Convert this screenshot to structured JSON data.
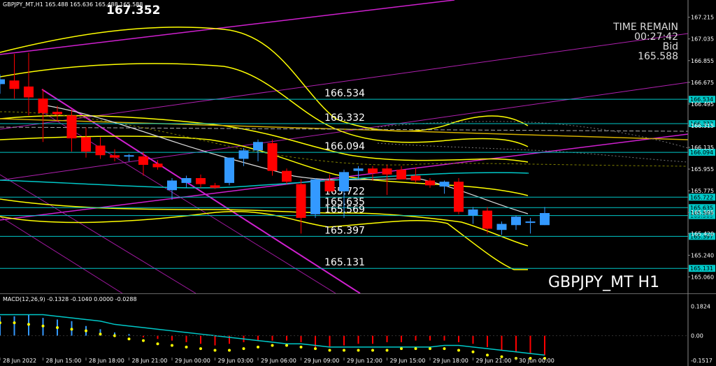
{
  "header": {
    "symbol_info": "GBPJPY_MT,H1  165.488 165.636 165.488 165.588",
    "big_price": "167.352"
  },
  "timer": {
    "label": "TIME REMAIN",
    "value": "00:27:42",
    "bid_label": "Bid",
    "bid_value": "165.588"
  },
  "watermark": "GBPJPY_MT H1",
  "colors": {
    "background": "#000000",
    "bull": "#3399ff",
    "bear": "#ff0000",
    "cyan": "#00c8c8",
    "yellow": "#ffff00",
    "magenta": "#d020d0",
    "grid": "#3a3a3a"
  },
  "chart_data": [
    {
      "type": "candlestick",
      "ylim": [
        164.97,
        167.3
      ],
      "y_ticks": [
        "167.215",
        "167.035",
        "166.855",
        "166.675",
        "166.495",
        "166.315",
        "166.135",
        "165.955",
        "165.775",
        "165.595",
        "165.420",
        "165.240",
        "165.060"
      ],
      "x_ticks": [
        "28 Jun 2022",
        "28 Jun 15:00",
        "28 Jun 18:00",
        "28 Jun 21:00",
        "29 Jun 00:00",
        "29 Jun 03:00",
        "29 Jun 06:00",
        "29 Jun 09:00",
        "29 Jun 12:00",
        "29 Jun 15:00",
        "29 Jun 18:00",
        "29 Jun 21:00",
        "30 Jun 00:00"
      ],
      "x_tick_bar_index": [
        0,
        3,
        6,
        9,
        12,
        15,
        18,
        21,
        24,
        27,
        30,
        33,
        36
      ],
      "candles": [
        {
          "o": 166.66,
          "h": 166.74,
          "l": 166.58,
          "c": 166.7
        },
        {
          "o": 166.69,
          "h": 166.91,
          "l": 166.54,
          "c": 166.62
        },
        {
          "o": 166.64,
          "h": 166.92,
          "l": 166.4,
          "c": 166.55
        },
        {
          "o": 166.54,
          "h": 166.62,
          "l": 166.18,
          "c": 166.42
        },
        {
          "o": 166.43,
          "h": 166.48,
          "l": 166.35,
          "c": 166.41
        },
        {
          "o": 166.4,
          "h": 166.45,
          "l": 166.1,
          "c": 166.21
        },
        {
          "o": 166.22,
          "h": 166.3,
          "l": 166.05,
          "c": 166.1
        },
        {
          "o": 166.15,
          "h": 166.22,
          "l": 166.04,
          "c": 166.07
        },
        {
          "o": 166.07,
          "h": 166.12,
          "l": 166.02,
          "c": 166.05
        },
        {
          "o": 166.06,
          "h": 166.08,
          "l": 166.02,
          "c": 166.07
        },
        {
          "o": 166.06,
          "h": 166.1,
          "l": 165.9,
          "c": 165.99
        },
        {
          "o": 166.0,
          "h": 166.03,
          "l": 165.95,
          "c": 165.97
        },
        {
          "o": 165.78,
          "h": 165.88,
          "l": 165.7,
          "c": 165.86
        },
        {
          "o": 165.84,
          "h": 165.9,
          "l": 165.8,
          "c": 165.88
        },
        {
          "o": 165.88,
          "h": 165.91,
          "l": 165.8,
          "c": 165.83
        },
        {
          "o": 165.82,
          "h": 165.84,
          "l": 165.79,
          "c": 165.8
        },
        {
          "o": 165.84,
          "h": 166.05,
          "l": 165.82,
          "c": 166.05
        },
        {
          "o": 166.04,
          "h": 166.13,
          "l": 165.98,
          "c": 166.11
        },
        {
          "o": 166.11,
          "h": 166.2,
          "l": 166.02,
          "c": 166.18
        },
        {
          "o": 166.17,
          "h": 166.2,
          "l": 165.9,
          "c": 165.94
        },
        {
          "o": 165.94,
          "h": 165.96,
          "l": 165.83,
          "c": 165.85
        },
        {
          "o": 165.83,
          "h": 165.87,
          "l": 165.42,
          "c": 165.55
        },
        {
          "o": 165.58,
          "h": 165.88,
          "l": 165.55,
          "c": 165.87
        },
        {
          "o": 165.86,
          "h": 165.91,
          "l": 165.76,
          "c": 165.77
        },
        {
          "o": 165.77,
          "h": 165.95,
          "l": 165.55,
          "c": 165.93
        },
        {
          "o": 165.94,
          "h": 165.98,
          "l": 165.87,
          "c": 165.96
        },
        {
          "o": 165.96,
          "h": 165.98,
          "l": 165.86,
          "c": 165.92
        },
        {
          "o": 165.96,
          "h": 165.99,
          "l": 165.74,
          "c": 165.91
        },
        {
          "o": 165.95,
          "h": 165.98,
          "l": 165.88,
          "c": 165.87
        },
        {
          "o": 165.9,
          "h": 165.97,
          "l": 165.84,
          "c": 165.86
        },
        {
          "o": 165.86,
          "h": 165.88,
          "l": 165.8,
          "c": 165.82
        },
        {
          "o": 165.81,
          "h": 165.86,
          "l": 165.75,
          "c": 165.85
        },
        {
          "o": 165.85,
          "h": 165.88,
          "l": 165.58,
          "c": 165.6
        },
        {
          "o": 165.57,
          "h": 165.64,
          "l": 165.5,
          "c": 165.62
        },
        {
          "o": 165.61,
          "h": 165.64,
          "l": 165.42,
          "c": 165.46
        },
        {
          "o": 165.45,
          "h": 165.52,
          "l": 165.41,
          "c": 165.5
        },
        {
          "o": 165.49,
          "h": 165.57,
          "l": 165.45,
          "c": 165.56
        },
        {
          "o": 165.52,
          "h": 165.55,
          "l": 165.42,
          "c": 165.52
        },
        {
          "o": 165.49,
          "h": 165.64,
          "l": 165.49,
          "c": 165.59
        }
      ],
      "levels": [
        {
          "value": 166.534,
          "label": "166.534"
        },
        {
          "value": 166.332,
          "label": "166.332"
        },
        {
          "value": 166.094,
          "label": "166.094"
        },
        {
          "value": 165.722,
          "label": "165.722"
        },
        {
          "value": 165.635,
          "label": "165.635"
        },
        {
          "value": 165.569,
          "label": "165.569"
        },
        {
          "value": 165.397,
          "label": "165.397"
        },
        {
          "value": 165.131,
          "label": "165.131"
        }
      ],
      "levels_right_only": [
        {
          "value": 165.589,
          "label": "165.589"
        }
      ]
    },
    {
      "type": "bar",
      "title": "MACD(12,26,9) -0.1328 -0.1040 0.0000 -0.0288",
      "ylim": [
        -0.17,
        0.21
      ],
      "y_ticks": [
        "0.1824",
        "0.00",
        "-0.1517"
      ],
      "histogram": [
        0.12,
        0.12,
        0.13,
        0.11,
        0.1,
        0.09,
        0.06,
        0.04,
        0.02,
        0.01,
        -0.01,
        -0.02,
        -0.03,
        -0.04,
        -0.05,
        -0.06,
        -0.05,
        -0.04,
        -0.03,
        -0.03,
        -0.03,
        -0.04,
        -0.07,
        -0.07,
        -0.06,
        -0.05,
        -0.05,
        -0.04,
        -0.04,
        -0.03,
        -0.03,
        -0.03,
        -0.04,
        -0.05,
        -0.07,
        -0.09,
        -0.1,
        -0.11,
        -0.12
      ],
      "signal": [
        0.13,
        0.13,
        0.13,
        0.13,
        0.12,
        0.11,
        0.1,
        0.09,
        0.07,
        0.06,
        0.05,
        0.04,
        0.03,
        0.02,
        0.01,
        0.0,
        -0.01,
        -0.02,
        -0.03,
        -0.04,
        -0.05,
        -0.05,
        -0.06,
        -0.07,
        -0.07,
        -0.07,
        -0.07,
        -0.07,
        -0.07,
        -0.07,
        -0.07,
        -0.06,
        -0.06,
        -0.07,
        -0.08,
        -0.09,
        -0.1,
        -0.11,
        -0.12
      ],
      "macd_line": [
        0.08,
        0.08,
        0.07,
        0.06,
        0.05,
        0.04,
        0.03,
        0.01,
        0.0,
        -0.02,
        -0.03,
        -0.05,
        -0.06,
        -0.07,
        -0.08,
        -0.09,
        -0.09,
        -0.08,
        -0.07,
        -0.06,
        -0.06,
        -0.07,
        -0.08,
        -0.09,
        -0.09,
        -0.09,
        -0.09,
        -0.09,
        -0.08,
        -0.08,
        -0.08,
        -0.08,
        -0.09,
        -0.1,
        -0.12,
        -0.13,
        -0.14,
        -0.14,
        -0.14
      ]
    }
  ]
}
